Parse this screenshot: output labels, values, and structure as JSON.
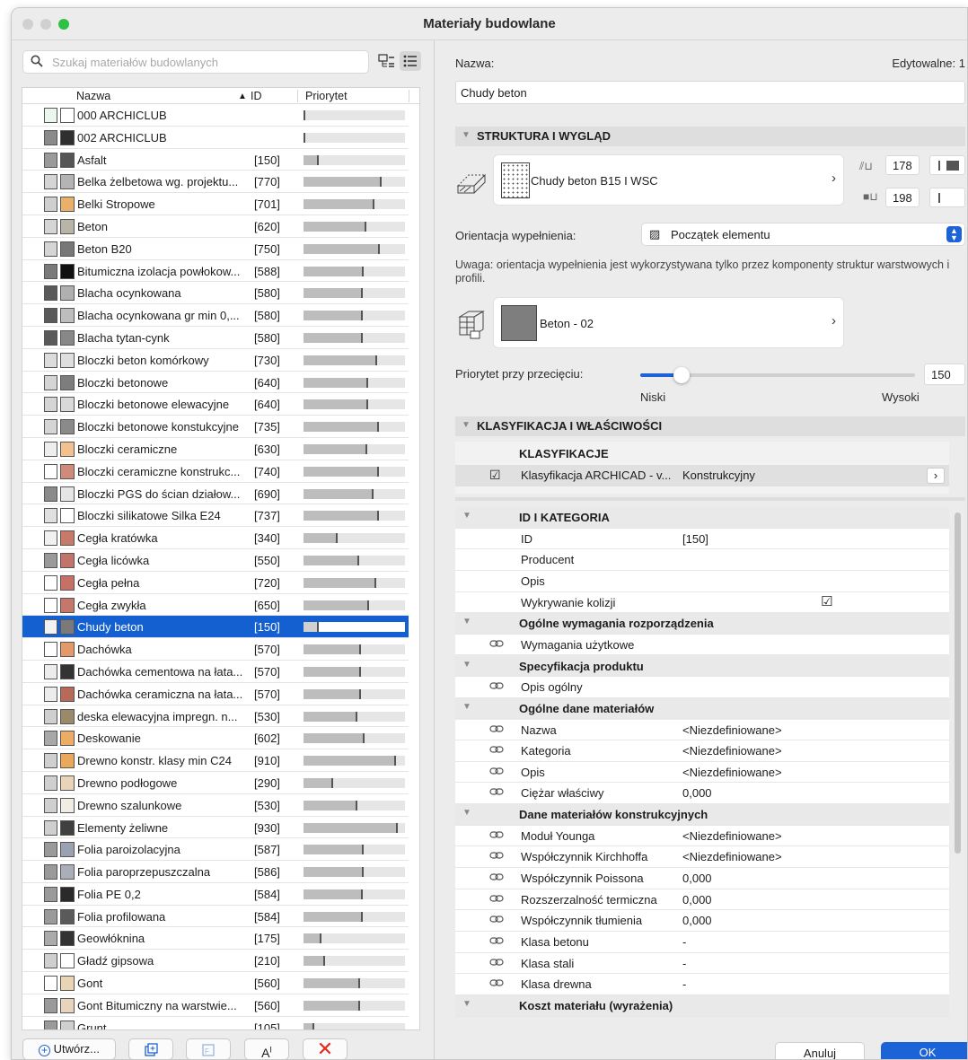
{
  "window": {
    "title": "Materiały budowlane"
  },
  "search": {
    "placeholder": "Szukaj materiałów budowlanych"
  },
  "table": {
    "col_name": "Nazwa",
    "col_id": "ID",
    "col_priority": "Priorytet",
    "rows": [
      {
        "name": "000 ARCHICLUB",
        "id": "",
        "priority": 0.01,
        "c1": "#eaf6ee",
        "c2": "#ffffff"
      },
      {
        "name": "002 ARCHICLUB",
        "id": "",
        "priority": 0.01,
        "c1": "#8a8a8a",
        "c2": "#2f2f2f"
      },
      {
        "name": "Asfalt",
        "id": "[150]",
        "priority": 0.15,
        "c1": "#9a9a9a",
        "c2": "#555555"
      },
      {
        "name": "Belka żelbetowa wg. projektu...",
        "id": "[770]",
        "priority": 0.77,
        "c1": "#d5d5d5",
        "c2": "#b4b4b4"
      },
      {
        "name": "Belki Stropowe",
        "id": "[701]",
        "priority": 0.7,
        "c1": "#cfcfcf",
        "c2": "#e8b06a"
      },
      {
        "name": "Beton",
        "id": "[620]",
        "priority": 0.62,
        "c1": "#d5d5d5",
        "c2": "#b8b4a8"
      },
      {
        "name": "Beton B20",
        "id": "[750]",
        "priority": 0.75,
        "c1": "#d5d5d5",
        "c2": "#777777"
      },
      {
        "name": "Bitumiczna izolacja powłokow...",
        "id": "[588]",
        "priority": 0.59,
        "c1": "#7a7a7a",
        "c2": "#111111"
      },
      {
        "name": "Blacha ocynkowana",
        "id": "[580]",
        "priority": 0.58,
        "c1": "#5a5a5a",
        "c2": "#b0b0b0"
      },
      {
        "name": "Blacha ocynkowana gr min 0,...",
        "id": "[580]",
        "priority": 0.58,
        "c1": "#5a5a5a",
        "c2": "#bdbdbd"
      },
      {
        "name": "Blacha tytan-cynk",
        "id": "[580]",
        "priority": 0.58,
        "c1": "#5a5a5a",
        "c2": "#888888"
      },
      {
        "name": "Bloczki beton komórkowy",
        "id": "[730]",
        "priority": 0.73,
        "c1": "#dcdcdc",
        "c2": "#dedede"
      },
      {
        "name": "Bloczki betonowe",
        "id": "[640]",
        "priority": 0.64,
        "c1": "#d5d5d5",
        "c2": "#7d7d7d"
      },
      {
        "name": "Bloczki betonowe elewacyjne",
        "id": "[640]",
        "priority": 0.64,
        "c1": "#d5d5d5",
        "c2": "#d9d9d9"
      },
      {
        "name": "Bloczki betonowe konstukcyjne",
        "id": "[735]",
        "priority": 0.74,
        "c1": "#d5d5d5",
        "c2": "#8a8a8a"
      },
      {
        "name": "Bloczki ceramiczne",
        "id": "[630]",
        "priority": 0.63,
        "c1": "#eeeeee",
        "c2": "#f1c290"
      },
      {
        "name": "Bloczki ceramiczne konstrukc...",
        "id": "[740]",
        "priority": 0.74,
        "c1": "#ffffff",
        "c2": "#d08a7a"
      },
      {
        "name": "Bloczki PGS do ścian działow...",
        "id": "[690]",
        "priority": 0.69,
        "c1": "#8a8a8a",
        "c2": "#e6e6e6"
      },
      {
        "name": "Bloczki silikatowe Silka E24",
        "id": "[737]",
        "priority": 0.74,
        "c1": "#e0e0e0",
        "c2": "#ffffff"
      },
      {
        "name": "Cegła kratówka",
        "id": "[340]",
        "priority": 0.34,
        "c1": "#f1f1f1",
        "c2": "#c77a6a"
      },
      {
        "name": "Cegła licówka",
        "id": "[550]",
        "priority": 0.55,
        "c1": "#9a9a9a",
        "c2": "#c2736a"
      },
      {
        "name": "Cegła pełna",
        "id": "[720]",
        "priority": 0.72,
        "c1": "#ffffff",
        "c2": "#c77066"
      },
      {
        "name": "Cegła zwykła",
        "id": "[650]",
        "priority": 0.65,
        "c1": "#ffffff",
        "c2": "#c5786a"
      },
      {
        "name": "Chudy beton",
        "id": "[150]",
        "priority": 0.15,
        "c1": "#f2f2f2",
        "c2": "#7a7a7a",
        "selected": true
      },
      {
        "name": "Dachówka",
        "id": "[570]",
        "priority": 0.57,
        "c1": "#ffffff",
        "c2": "#e29a6a"
      },
      {
        "name": "Dachówka cementowa na łata...",
        "id": "[570]",
        "priority": 0.57,
        "c1": "#ececec",
        "c2": "#333333"
      },
      {
        "name": "Dachówka ceramiczna na łata...",
        "id": "[570]",
        "priority": 0.57,
        "c1": "#ececec",
        "c2": "#b86a58"
      },
      {
        "name": "deska elewacyjna impregn. n...",
        "id": "[530]",
        "priority": 0.53,
        "c1": "#cfcfcf",
        "c2": "#9a8a6a"
      },
      {
        "name": "Deskowanie",
        "id": "[602]",
        "priority": 0.6,
        "c1": "#a8a8a8",
        "c2": "#ecac64"
      },
      {
        "name": "Drewno konstr. klasy min C24",
        "id": "[910]",
        "priority": 0.91,
        "c1": "#cfcfcf",
        "c2": "#e9a85a"
      },
      {
        "name": "Drewno podłogowe",
        "id": "[290]",
        "priority": 0.29,
        "c1": "#cfcfcf",
        "c2": "#e8d4b8"
      },
      {
        "name": "Drewno szalunkowe",
        "id": "[530]",
        "priority": 0.53,
        "c1": "#cfcfcf",
        "c2": "#f1ece4"
      },
      {
        "name": "Elementy żeliwne",
        "id": "[930]",
        "priority": 0.93,
        "c1": "#cfcfcf",
        "c2": "#404040"
      },
      {
        "name": "Folia paroizolacyjna",
        "id": "[587]",
        "priority": 0.59,
        "c1": "#9a9a9a",
        "c2": "#9aa2b2"
      },
      {
        "name": "Folia paroprzepuszczalna",
        "id": "[586]",
        "priority": 0.59,
        "c1": "#9a9a9a",
        "c2": "#a9aeb8"
      },
      {
        "name": "Folia PE 0,2",
        "id": "[584]",
        "priority": 0.58,
        "c1": "#9a9a9a",
        "c2": "#2a2a2a"
      },
      {
        "name": "Folia profilowana",
        "id": "[584]",
        "priority": 0.58,
        "c1": "#9a9a9a",
        "c2": "#5a5a5a"
      },
      {
        "name": "Geowłóknina",
        "id": "[175]",
        "priority": 0.18,
        "c1": "#aaaaaa",
        "c2": "#333333"
      },
      {
        "name": "Gładź gipsowa",
        "id": "[210]",
        "priority": 0.21,
        "c1": "#cfcfcf",
        "c2": "#ffffff"
      },
      {
        "name": "Gont",
        "id": "[560]",
        "priority": 0.56,
        "c1": "#ffffff",
        "c2": "#e9d4b4"
      },
      {
        "name": "Gont Bitumiczny na warstwie...",
        "id": "[560]",
        "priority": 0.56,
        "c1": "#9a9a9a",
        "c2": "#e6d4bc"
      },
      {
        "name": "Grunt",
        "id": "[105]",
        "priority": 0.11,
        "c1": "#9a9a9a",
        "c2": "#cfcfcf"
      }
    ]
  },
  "bottom": {
    "create_label": "Utwórz..."
  },
  "right": {
    "name_label": "Nazwa:",
    "editable_label": "Edytowalne: 1",
    "name_value": "Chudy beton",
    "section1": "STRUKTURA I WYGLĄD",
    "fill_name": "Chudy beton B15 I WSC",
    "pen1": "178",
    "pen2": "198",
    "orientation_label": "Orientacja wypełnienia:",
    "orientation_value": "Początek elementu",
    "note": "Uwaga: orientacja wypełnienia jest wykorzystywana tylko przez komponenty struktur warstwowych i profili.",
    "surface_name": "Beton - 02",
    "priority_label": "Priorytet przy przecięciu:",
    "priority_value": "150",
    "priority_fraction": 0.15,
    "low_label": "Niski",
    "high_label": "Wysoki",
    "section2": "KLASYFIKACJA I WŁAŚCIWOŚCI",
    "class_header": "KLASYFIKACJE",
    "class_name": "Klasyfikacja ARCHICAD - v...",
    "class_value": "Konstrukcyjny",
    "cancel_label": "Anuluj",
    "ok_label": "OK"
  },
  "properties": [
    {
      "name": "ID I KATEGORIA",
      "value": "",
      "type": "group"
    },
    {
      "name": "ID",
      "value": "[150]",
      "type": "plain"
    },
    {
      "name": "Producent",
      "value": "",
      "type": "plain"
    },
    {
      "name": "Opis",
      "value": "",
      "type": "plain"
    },
    {
      "name": "Wykrywanie kolizji",
      "value": "",
      "type": "check"
    },
    {
      "name": "Ogólne wymagania rozporządzenia",
      "value": "",
      "type": "group"
    },
    {
      "name": "Wymagania użytkowe",
      "value": "",
      "type": "link"
    },
    {
      "name": "Specyfikacja produktu",
      "value": "",
      "type": "group"
    },
    {
      "name": "Opis ogólny",
      "value": "",
      "type": "link"
    },
    {
      "name": "Ogólne dane materiałów",
      "value": "",
      "type": "group"
    },
    {
      "name": "Nazwa",
      "value": "<Niezdefiniowane>",
      "type": "link"
    },
    {
      "name": "Kategoria",
      "value": "<Niezdefiniowane>",
      "type": "link"
    },
    {
      "name": "Opis",
      "value": "<Niezdefiniowane>",
      "type": "link"
    },
    {
      "name": "Ciężar właściwy",
      "value": "0,000",
      "type": "link"
    },
    {
      "name": "Dane materiałów konstrukcyjnych",
      "value": "",
      "type": "group"
    },
    {
      "name": "Moduł Younga",
      "value": "<Niezdefiniowane>",
      "type": "link"
    },
    {
      "name": "Współczynnik Kirchhoffa",
      "value": "<Niezdefiniowane>",
      "type": "link"
    },
    {
      "name": "Współczynnik Poissona",
      "value": "0,000",
      "type": "link"
    },
    {
      "name": "Rozszerzalność termiczna",
      "value": "0,000",
      "type": "link"
    },
    {
      "name": "Współczynnik tłumienia",
      "value": "0,000",
      "type": "link"
    },
    {
      "name": "Klasa betonu",
      "value": "-",
      "type": "link"
    },
    {
      "name": "Klasa stali",
      "value": "-",
      "type": "link"
    },
    {
      "name": "Klasa drewna",
      "value": "-",
      "type": "link"
    },
    {
      "name": "Koszt materiału (wyrażenia)",
      "value": "",
      "type": "group"
    }
  ]
}
